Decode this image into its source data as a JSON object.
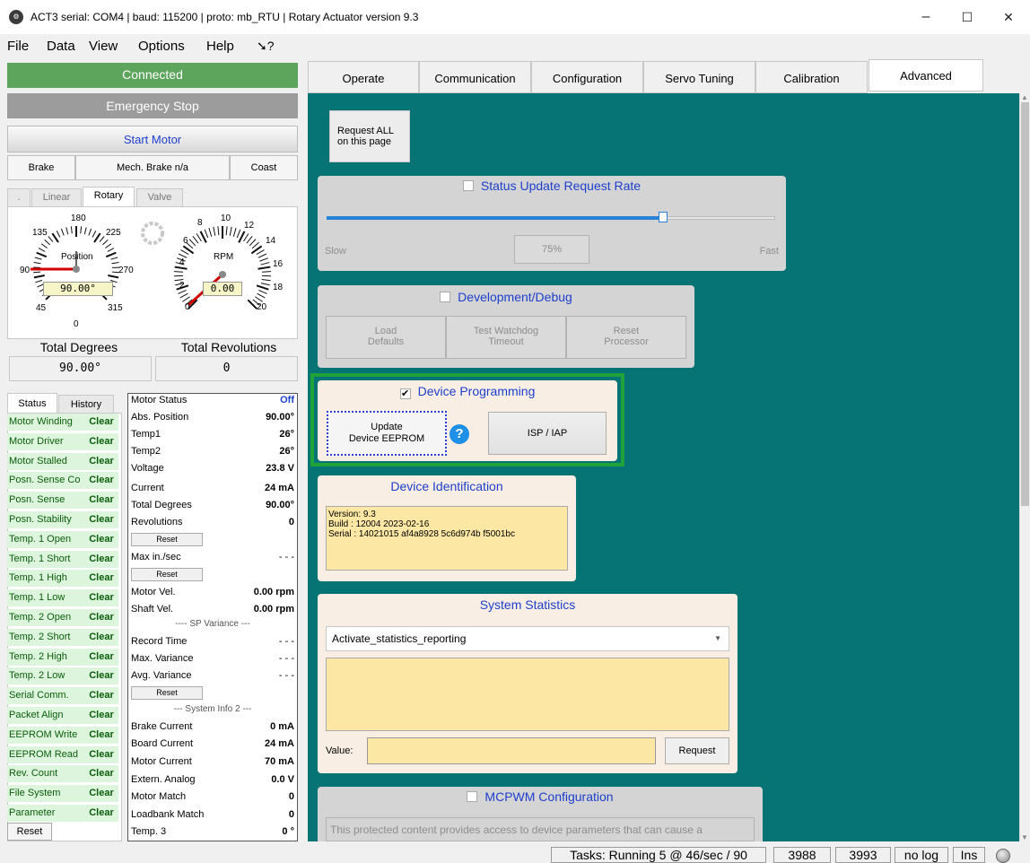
{
  "window": {
    "title": "ACT3  serial: COM4  |  baud: 115200  |  proto: mb_RTU  |  Rotary Actuator version 9.3",
    "icon_name": "app-gear-icon",
    "minimize": "–",
    "maximize": "☐",
    "close": "✕"
  },
  "menu": [
    "File",
    "Data",
    "View",
    "Options",
    "Help"
  ],
  "left": {
    "connected": "Connected",
    "estop": "Emergency Stop",
    "start_motor": "Start Motor",
    "brake": "Brake",
    "mech_brake": "Mech. Brake n/a",
    "coast": "Coast",
    "mode_tabs": [
      ".",
      "Linear",
      "Rotary",
      "Valve"
    ],
    "position_gauge": {
      "ticks": [
        "180",
        "135",
        "225",
        "90",
        "270",
        "45",
        "315",
        "0"
      ],
      "label": "Position",
      "readout": "90.00°"
    },
    "rpm_gauge": {
      "ticks": [
        "8",
        "10",
        "12",
        "6",
        "14",
        "4",
        "16",
        "2",
        "18",
        "0",
        "20"
      ],
      "label": "RPM",
      "readout": "0.00"
    },
    "total_degrees_label": "Total Degrees",
    "total_revolutions_label": "Total Revolutions",
    "total_degrees_value": "90.00°",
    "total_revolutions_value": "0",
    "status_tabs": [
      "Status",
      "History"
    ],
    "status_items": [
      {
        "label": "Motor Winding",
        "value": "Clear"
      },
      {
        "label": "Motor Driver",
        "value": "Clear"
      },
      {
        "label": "Motor Stalled",
        "value": "Clear"
      },
      {
        "label": "Posn. Sense Co",
        "value": "Clear"
      },
      {
        "label": "Posn. Sense",
        "value": "Clear"
      },
      {
        "label": "Posn. Stability",
        "value": "Clear"
      },
      {
        "label": "Temp. 1 Open",
        "value": "Clear"
      },
      {
        "label": "Temp. 1 Short",
        "value": "Clear"
      },
      {
        "label": "Temp. 1 High",
        "value": "Clear"
      },
      {
        "label": "Temp. 1 Low",
        "value": "Clear"
      },
      {
        "label": "Temp. 2 Open",
        "value": "Clear"
      },
      {
        "label": "Temp. 2 Short",
        "value": "Clear"
      },
      {
        "label": "Temp. 2 High",
        "value": "Clear"
      },
      {
        "label": "Temp. 2 Low",
        "value": "Clear"
      },
      {
        "label": "Serial Comm.",
        "value": "Clear"
      },
      {
        "label": "Packet Align",
        "value": "Clear"
      },
      {
        "label": "EEPROM Write",
        "value": "Clear"
      },
      {
        "label": "EEPROM Read",
        "value": "Clear"
      },
      {
        "label": "Rev. Count",
        "value": "Clear"
      },
      {
        "label": "File System",
        "value": "Clear"
      },
      {
        "label": "Parameter",
        "value": "Clear"
      }
    ],
    "status_reset": "Reset",
    "motor_status": {
      "header_label": "Motor Status",
      "header_value": "Off",
      "abs_position": {
        "label": "Abs. Position",
        "value": "90.00°"
      },
      "temp1": {
        "label": "Temp1",
        "value": "26°"
      },
      "temp2": {
        "label": "Temp2",
        "value": "26°"
      },
      "voltage": {
        "label": "Voltage",
        "value": "23.8 V"
      },
      "current": {
        "label": "Current",
        "value": "24 mA"
      },
      "total_degrees": {
        "label": "Total Degrees",
        "value": "90.00°"
      },
      "revolutions": {
        "label": "Revolutions",
        "value": "0"
      },
      "reset1": "Reset",
      "max_in_sec": {
        "label": "Max in./sec",
        "value": "- - -"
      },
      "reset2": "Reset",
      "motor_vel": {
        "label": "Motor Vel.",
        "value": "0.00 rpm"
      },
      "shaft_vel": {
        "label": "Shaft Vel.",
        "value": "0.00 rpm"
      },
      "sp_variance": "---- SP Variance ---",
      "record_time": {
        "label": "Record Time",
        "value": "- - -"
      },
      "max_variance": {
        "label": "Max. Variance",
        "value": "- - -"
      },
      "avg_variance": {
        "label": "Avg. Variance",
        "value": "- - -"
      },
      "reset3": "Reset",
      "system_info2": "--- System Info 2 ---",
      "brake_current": {
        "label": "Brake Current",
        "value": "0 mA"
      },
      "board_current": {
        "label": "Board Current",
        "value": "24 mA"
      },
      "motor_current": {
        "label": "Motor Current",
        "value": "70 mA"
      },
      "extern_analog": {
        "label": "Extern. Analog",
        "value": "0.0 V"
      },
      "motor_match": {
        "label": "Motor Match",
        "value": "0"
      },
      "loadbank_match": {
        "label": "Loadbank Match",
        "value": "0"
      },
      "temp3": {
        "label": "Temp. 3",
        "value": "0 °"
      }
    }
  },
  "tabs": [
    "Operate",
    "Communication",
    "Configuration",
    "Servo Tuning",
    "Calibration",
    "Advanced"
  ],
  "advanced": {
    "request_all": [
      "Request ALL",
      "on this page"
    ],
    "status_rate": {
      "title": "Status Update Request Rate",
      "slow": "Slow",
      "fast": "Fast",
      "value_label": "75%",
      "fraction": 0.75
    },
    "dev_debug": {
      "title": "Development/Debug",
      "load_defaults": [
        "Load",
        "Defaults"
      ],
      "test_watchdog": [
        "Test Watchdog",
        "Timeout"
      ],
      "reset_processor": [
        "Reset",
        "Processor"
      ]
    },
    "device_programming": {
      "title": "Device Programming",
      "check": "✔",
      "update": [
        "Update",
        "Device EEPROM"
      ],
      "help": "?",
      "isp": "ISP / IAP"
    },
    "device_identification": {
      "title": "Device Identification",
      "version": "Version: 9.3",
      "build": "Build  : 12004 2023-02-16",
      "serial": "Serial : 14021015 af4a8928 5c6d974b f5001bc"
    },
    "system_statistics": {
      "title": "System Statistics",
      "select": "Activate_statistics_reporting",
      "value_label": "Value:",
      "request": "Request"
    },
    "mcpwm": {
      "title": "MCPWM Configuration",
      "note": "This protected content provides access to device parameters that can cause a"
    }
  },
  "statusbar": {
    "tasks": "Tasks: Running 5 @ 46/sec / 90",
    "n1": "3988",
    "n2": "3993",
    "log": "no log",
    "ins": "Ins"
  },
  "colors": {
    "teal": "#067475",
    "connected": "#5da55d",
    "highlight_border": "#1fa23a",
    "status_green_bg": "#dcf5dc",
    "blue_text": "#1e3fcc"
  }
}
